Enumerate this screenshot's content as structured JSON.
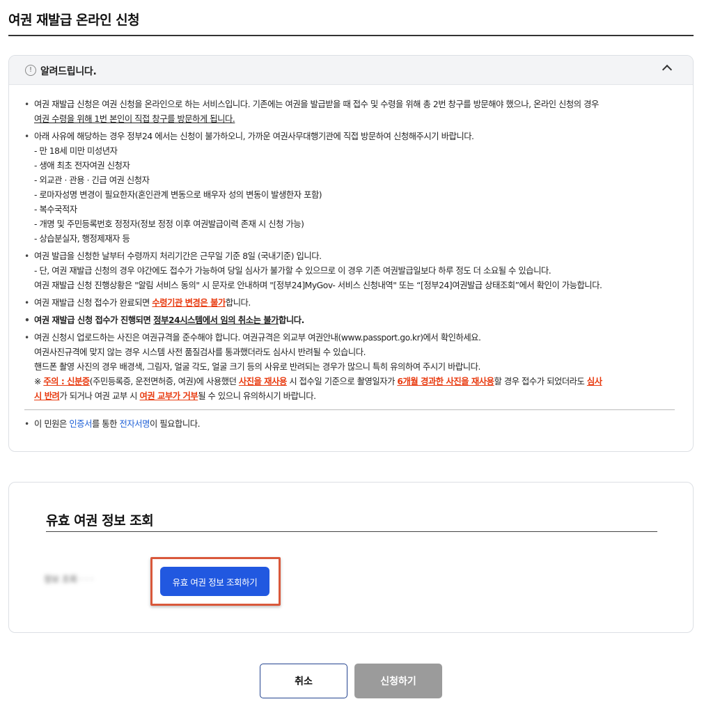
{
  "page": {
    "title": "여권 재발급 온라인 신청"
  },
  "notice": {
    "icon": "info-circle-icon",
    "title": "알려드립니다.",
    "items": {
      "i1": {
        "l1": "여권 재발급 신청은 여권 신청을 온라인으로 하는 서비스입니다. 기존에는 여권을 발급받을 때 접수 및 수령을 위해 총 2번 창구를 방문해야 했으나, 온라인 신청의 경우",
        "l2": "여권 수령을 위해 1번 본인이 직접 창구를 방문하게 됩니다."
      },
      "i2": {
        "l1": "아래 사유에 해당하는 경우 정부24 에서는 신청이 불가하오니, 가까운 여권사무대행기관에 직접 방문하여 신청해주시기 바랍니다.",
        "subs": [
          "- 만 18세 미만 미성년자",
          "- 생애 최초 전자여권 신청자",
          "- 외교관 · 관용 · 긴급 여권 신청자",
          "- 로마자성명 변경이 필요한자(혼인관계 변동으로 배우자 성의 변동이 발생한자 포함)",
          "- 복수국적자",
          "- 개명 및 주민등록번호 정정자(정보 정정 이후 여권발급이력 존재 시 신청 가능)",
          "- 상습분실자, 행정제재자 등"
        ]
      },
      "i3": {
        "l1": "여권 발급을 신청한 날부터 수령까지 처리기간은 근무일 기준 8일 (국내기준) 입니다.",
        "l2": "- 단, 여권 재발급 신청의 경우 야간에도 접수가 가능하여 당일 심사가 불가할 수 있으므로 이 경우 기존 여권발급일보다 하루 정도 더 소요될 수 있습니다.",
        "l3": "여권 재발급 신청 진행상황은 \"알림 서비스 동의\" 시 문자로 안내하며 \"[정부24]MyGov- 서비스 신청내역\" 또는 “[정부24]여권발급 상태조회”에서 확인이 가능합니다."
      },
      "i4": {
        "a": "여권 재발급 신청 접수가 완료되면 ",
        "b": "수령기관 변경은 불가",
        "c": "합니다."
      },
      "i5": {
        "a": "여권 재발급 신청 접수가 진행되면 ",
        "b": "정부24시스템에서 임의 취소는 불가",
        "c": "합니다."
      },
      "i6": {
        "l1": "여권 신청시 업로드하는 사진은 여권규격을 준수해야 합니다. 여권규격은 외교부 여권안내(www.passport.go.kr)에서 확인하세요.",
        "l2": "여권사진규격에 맞지 않는 경우 시스템 사전 품질검사를 통과했더라도 심사시 반려될 수 있습니다.",
        "l3": "핸드폰 촬영 사진의 경우 배경색, 그림자, 얼굴 각도, 얼굴 크기 등의 사유로 반려되는 경우가 많으니 특히 유의하여 주시기 바랍니다.",
        "l4a": "※ ",
        "l4b": "주의 : 신분증",
        "l4c": "(주민등록증, 운전면허증, 여권)에 사용했던 ",
        "l4d": "사진을 재사용",
        "l4e": " 시 접수일 기준으로 촬영일자가 ",
        "l4f": "6개월 경과한 사진을 재사용",
        "l4g": "할 경우 접수가 되었더라도 ",
        "l4h": "심사",
        "l5a": "시 반려",
        "l5b": "가 되거나 여권 교부 시 ",
        "l5c": "여권 교부가 거부",
        "l5d": "될 수 있으니 유의하시기 바랍니다."
      },
      "i7": {
        "a": "이 민원은 ",
        "b": "인증서",
        "c": "를 통한 ",
        "d": "전자서명",
        "e": "이 필요합니다."
      }
    }
  },
  "lookup": {
    "title": "유효 여권 정보 조회",
    "blurred": "정보 조회 ·  · ·",
    "button_label": "유효 여권 정보 조회하기"
  },
  "actions": {
    "cancel_label": "취소",
    "apply_label": "신청하기"
  },
  "colors": {
    "primary": "#2158e0",
    "highlight": "#d9583b",
    "warning": "#e8390e",
    "link": "#1d5fd6",
    "disabled": "#9b9b9b"
  }
}
